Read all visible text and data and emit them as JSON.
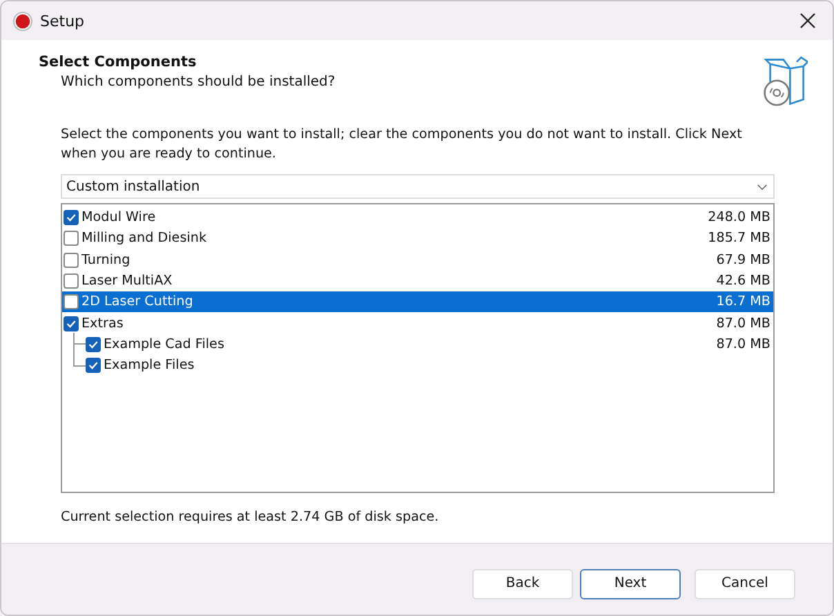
{
  "window": {
    "title": "Setup"
  },
  "header": {
    "title": "Select Components",
    "subtitle": "Which components should be installed?"
  },
  "instructions": "Select the components you want to install; clear the components you do not want to install. Click Next when you are ready to continue.",
  "install_type": {
    "value": "Custom installation"
  },
  "components": [
    {
      "label": "Modul Wire",
      "size": "248.0 MB",
      "checked": true,
      "selected": false
    },
    {
      "label": "Milling and Diesink",
      "size": "185.7 MB",
      "checked": false,
      "selected": false
    },
    {
      "label": "Turning",
      "size": "67.9 MB",
      "checked": false,
      "selected": false
    },
    {
      "label": "Laser MultiAX",
      "size": "42.6 MB",
      "checked": false,
      "selected": false
    },
    {
      "label": "2D Laser Cutting",
      "size": "16.7 MB",
      "checked": false,
      "selected": true
    },
    {
      "label": "Extras",
      "size": "87.0 MB",
      "checked": true,
      "selected": false,
      "children": [
        {
          "label": "Example Cad Files",
          "size": "87.0 MB",
          "checked": true,
          "selected": false
        },
        {
          "label": "Example Files",
          "checked": true,
          "selected": false
        }
      ]
    }
  ],
  "disk_space": "Current selection requires at least 2.74 GB of disk space.",
  "buttons": [
    {
      "label": "Back",
      "focused": false
    },
    {
      "label": "Next",
      "focused": true
    },
    {
      "label": "Cancel",
      "focused": false
    }
  ]
}
